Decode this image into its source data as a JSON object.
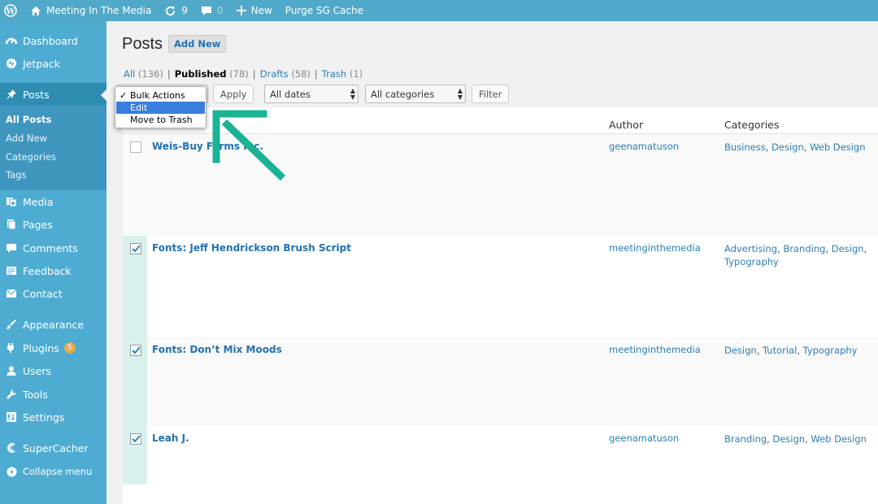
{
  "colors": {
    "admin_bar": "#51a9ca",
    "sidebar": "#4eacd3",
    "sidebar_current": "#2e8cb3",
    "link": "#2271b1",
    "arrow": "#1ab394",
    "selection": "#3b7ddc"
  },
  "admin_bar": {
    "logo_icon": "wordpress-icon",
    "site_icon": "home-icon",
    "site_name": "Meeting In The Media",
    "updates_icon": "refresh-icon",
    "updates_count": "9",
    "comments_icon": "comment-icon",
    "comments_count": "0",
    "new_icon": "plus-icon",
    "new_label": "New",
    "purge_label": "Purge SG Cache"
  },
  "sidebar": {
    "items": [
      {
        "label": "Dashboard",
        "icon": "dashboard-icon"
      },
      {
        "label": "Jetpack",
        "icon": "jetpack-icon"
      },
      {
        "label": "Posts",
        "icon": "pin-icon"
      },
      {
        "label": "Media",
        "icon": "media-icon"
      },
      {
        "label": "Pages",
        "icon": "pages-icon"
      },
      {
        "label": "Comments",
        "icon": "comments-icon"
      },
      {
        "label": "Feedback",
        "icon": "feedback-icon"
      },
      {
        "label": "Contact",
        "icon": "mail-icon"
      },
      {
        "label": "Appearance",
        "icon": "brush-icon"
      },
      {
        "label": "Plugins",
        "icon": "plugin-icon",
        "badge": "5"
      },
      {
        "label": "Users",
        "icon": "user-icon"
      },
      {
        "label": "Tools",
        "icon": "wrench-icon"
      },
      {
        "label": "Settings",
        "icon": "settings-icon"
      },
      {
        "label": "SuperCacher",
        "icon": "supercacher-icon"
      },
      {
        "label": "Collapse menu",
        "icon": "collapse-icon"
      }
    ],
    "submenu": [
      "All Posts",
      "Add New",
      "Categories",
      "Tags"
    ]
  },
  "main": {
    "title": "Posts",
    "add_new": "Add New",
    "views": {
      "all": "All",
      "all_count": "(136)",
      "published": "Published",
      "published_count": "(78)",
      "drafts": "Drafts",
      "drafts_count": "(58)",
      "trash": "Trash",
      "trash_count": "(1)",
      "sep": "|"
    },
    "bulk": {
      "apply": "Apply",
      "filter": "Filter"
    },
    "dates_select": "All dates",
    "categories_select": "All categories",
    "bulk_menu": {
      "checkmark": "✓",
      "options": [
        "Bulk Actions",
        "Edit",
        "Move to Trash"
      ],
      "highlighted": "Edit"
    },
    "columns": {
      "author": "Author",
      "categories": "Categories"
    },
    "rows": [
      {
        "title": "Weis-Buy Farms Inc.",
        "author": "geenamatuson",
        "categories": [
          "Business",
          "Design",
          "Web Design"
        ],
        "checked": false
      },
      {
        "title": "Fonts: Jeff Hendrickson Brush Script",
        "author": "meetinginthemedia",
        "categories": [
          "Advertising",
          "Branding",
          "Design",
          "Typography"
        ],
        "checked": true
      },
      {
        "title": "Fonts: Don’t Mix Moods",
        "author": "meetinginthemedia",
        "categories": [
          "Design",
          "Tutorial",
          "Typography"
        ],
        "checked": true
      },
      {
        "title": "Leah J.",
        "author": "geenamatuson",
        "categories": [
          "Branding",
          "Design",
          "Web Design"
        ],
        "checked": true
      }
    ]
  }
}
